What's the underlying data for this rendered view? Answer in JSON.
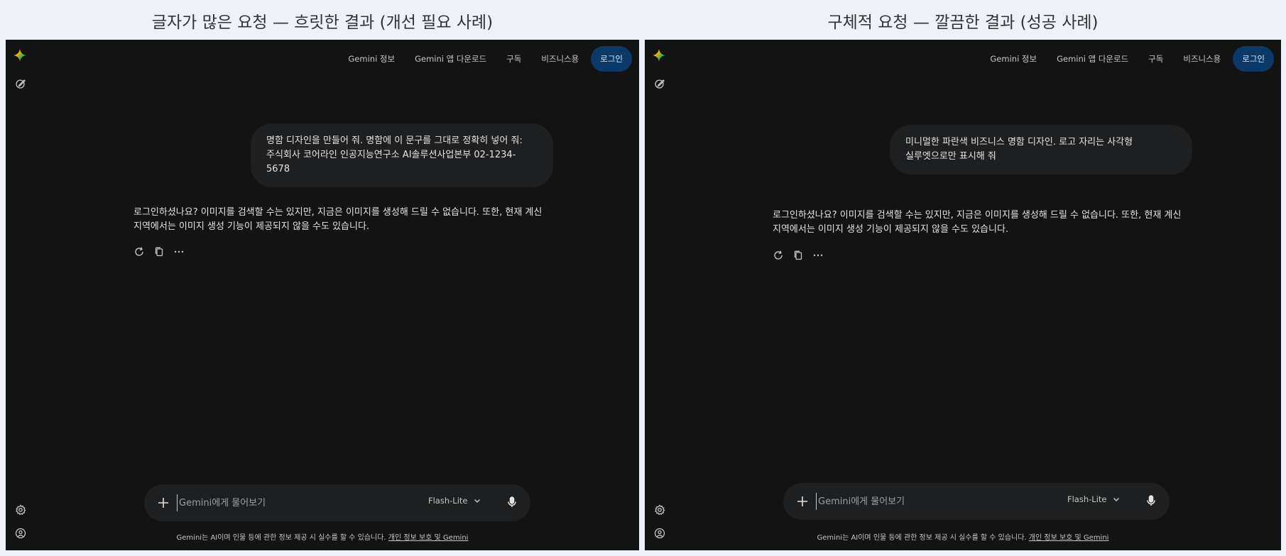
{
  "left": {
    "heading": "글자가 많은 요청 — 흐릿한 결과 (개선 필요 사례)",
    "nav": [
      "Gemini 정보",
      "Gemini 앱 다운로드",
      "구독",
      "비즈니스용"
    ],
    "login": "로그인",
    "user_message": "명함 디자인을 만들어 줘. 명함에 이 문구를 그대로 정확히 넣어 줘:\n주식회사 코어라인 인공지능연구소 AI솔루션사업본부 02-1234-5678",
    "response": "로그인하셨나요? 이미지를 검색할 수는 있지만, 지금은 이미지를 생성해 드릴 수 없습니다. 또한, 현재 계신 지역에서는 이미지 생성 기능이 제공되지 않을 수도 있습니다.",
    "input_placeholder": "Gemini에게 물어보기",
    "model": "Flash-Lite",
    "disclaimer_text": "Gemini는 AI이며 인물 등에 관한 정보 제공 시 실수를 할 수 있습니다.",
    "disclaimer_link": "개인 정보 보호 및 Gemini"
  },
  "right": {
    "heading": "구체적 요청 — 깔끔한 결과 (성공 사례)",
    "nav": [
      "Gemini 정보",
      "Gemini 앱 다운로드",
      "구독",
      "비즈니스용"
    ],
    "login": "로그인",
    "user_message": "미니멀한 파란색 비즈니스 명함 디자인. 로고 자리는 사각형\n실루엣으로만 표시해 줘",
    "response": "로그인하셨나요? 이미지를 검색할 수는 있지만, 지금은 이미지를 생성해 드릴 수 없습니다. 또한, 현재 계신 지역에서는 이미지 생성 기능이 제공되지 않을 수도 있습니다.",
    "input_placeholder": "Gemini에게 물어보기",
    "model": "Flash-Lite",
    "disclaimer_text": "Gemini는 AI이며 인물 등에 관한 정보 제공 시 실수를 할 수 있습니다.",
    "disclaimer_link": "개인 정보 보호 및 Gemini"
  },
  "colors": {
    "page_bg": "#eef2f8",
    "panel_bg": "#131314",
    "bubble_bg": "#1e1f20",
    "login_bg": "#0b3a69",
    "text": "#e3e3e3"
  }
}
